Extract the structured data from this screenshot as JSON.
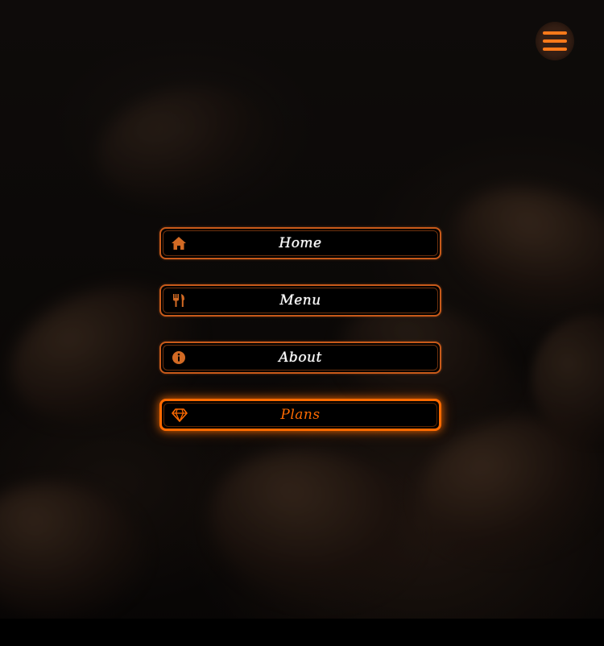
{
  "menu_toggle": {
    "icon": "hamburger-menu-icon"
  },
  "nav": {
    "items": [
      {
        "label": "Home",
        "icon": "home-icon"
      },
      {
        "label": "Menu",
        "icon": "utensils-icon"
      },
      {
        "label": "About",
        "icon": "info-circle-icon"
      },
      {
        "label": "Plans",
        "icon": "gem-icon",
        "active": true
      }
    ]
  },
  "colors": {
    "accent": "#ff6a00",
    "border": "#c85a1a",
    "icon": "#d26a24",
    "button_bg": "#000000",
    "text": "#ffffff"
  }
}
